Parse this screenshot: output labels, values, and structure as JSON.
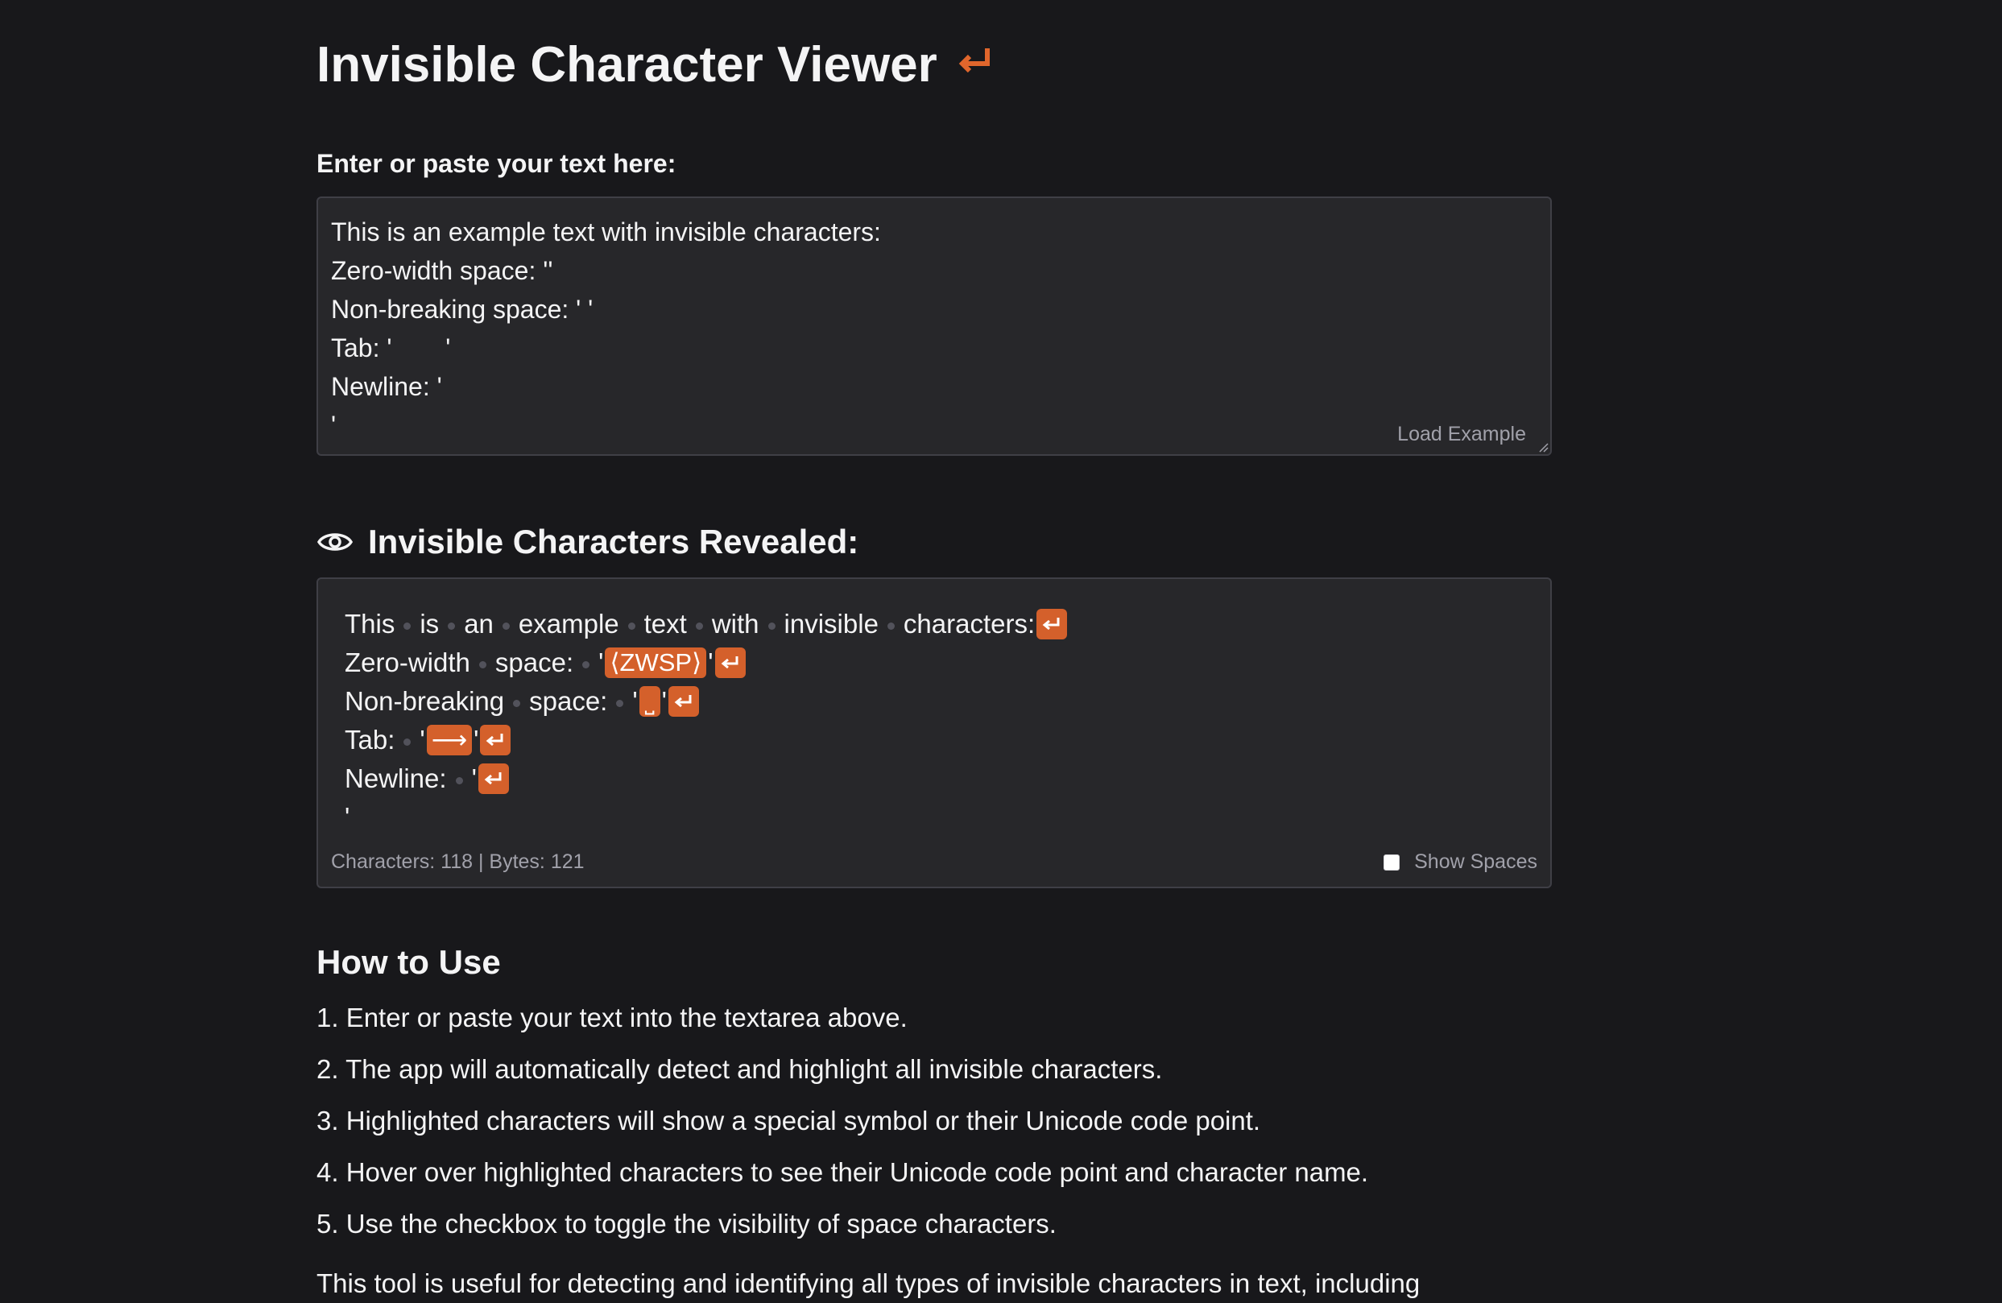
{
  "header": {
    "title": "Invisible Character Viewer",
    "title_icon": "return-arrow-icon"
  },
  "input": {
    "label": "Enter or paste your text here:",
    "value": "This is an example text with invisible characters:\nZero-width space: ''\nNon-breaking space: ' '\nTab: '\t'\nNewline: '\n'",
    "load_example_label": "Load Example"
  },
  "reveal": {
    "heading": "Invisible Characters Revealed:",
    "heading_icon": "eye-icon",
    "lines": {
      "line1": {
        "words": [
          "This",
          "is",
          "an",
          "example",
          "text",
          "with",
          "invisible",
          "characters:"
        ]
      },
      "line2": {
        "w1": "Zero-width",
        "w2": "space:",
        "q": "'",
        "zwsp": "⟨ZWSP⟩"
      },
      "line3": {
        "w1": "Non-breaking",
        "w2": "space:",
        "q": "'",
        "nbsp": "˽"
      },
      "line4": {
        "w1": "Tab:",
        "q": "'",
        "tab": "⟶"
      },
      "line5": {
        "w1": "Newline:",
        "q": "'"
      },
      "line6": {
        "q": "'"
      }
    },
    "stats": "Characters: 118 | Bytes: 121",
    "show_spaces_label": "Show Spaces",
    "show_spaces_checked": false
  },
  "howto": {
    "heading": "How to Use",
    "steps": [
      "1. Enter or paste your text into the textarea above.",
      "2. The app will automatically detect and highlight all invisible characters.",
      "3. Highlighted characters will show a special symbol or their Unicode code point.",
      "4. Hover over highlighted characters to see their Unicode code point and character name.",
      "5. Use the checkbox to toggle the visibility of space characters."
    ],
    "cut_paragraph": "This tool is useful for detecting and identifying all types of invisible characters in text, including"
  },
  "colors": {
    "background": "#18181b",
    "panel": "#27272a",
    "border": "#3f3f46",
    "accent": "#d4602b",
    "muted_text": "#a1a1aa"
  }
}
